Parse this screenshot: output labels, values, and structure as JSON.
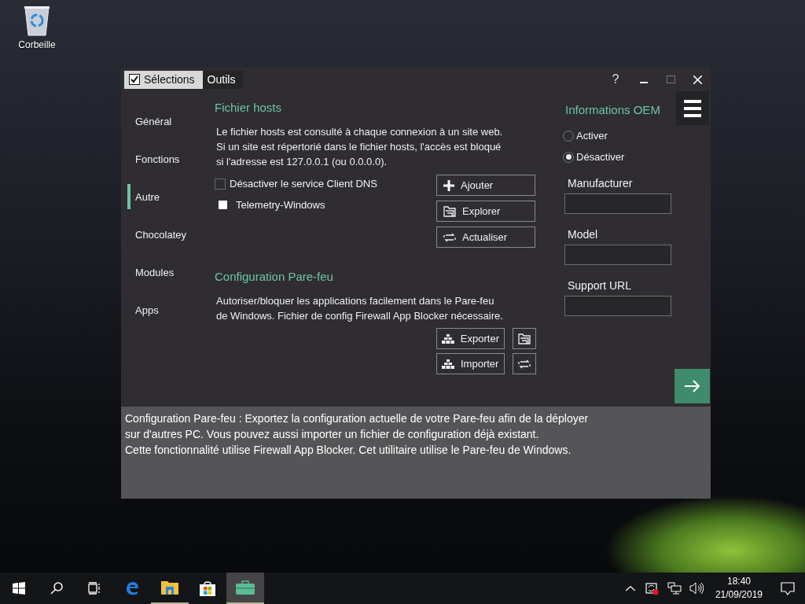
{
  "desktop_icons": [
    {
      "label": "Corbeille"
    }
  ],
  "window": {
    "tabs": [
      {
        "label": "Sélections",
        "selected": true,
        "checked": true
      },
      {
        "label": "Outils",
        "selected": false,
        "checked": false
      }
    ],
    "help": "?"
  },
  "sidebar": {
    "items": [
      {
        "label": "Général",
        "selected": false
      },
      {
        "label": "Fonctions",
        "selected": false
      },
      {
        "label": "Autre",
        "selected": true
      },
      {
        "label": "Chocolatey",
        "selected": false
      },
      {
        "label": "Modules",
        "selected": false
      },
      {
        "label": "Apps",
        "selected": false
      }
    ]
  },
  "hosts": {
    "title": "Fichier hosts",
    "description": "Le fichier hosts est consulté à chaque connexion à un site web.\nSi un site est répertorié dans le fichier hosts, l'accès est bloqué\nsi l'adresse est 127.0.0.1 (ou 0.0.0.0).",
    "options": [
      {
        "label": "Désactiver le service Client DNS",
        "kind": "checkbox",
        "checked": false
      },
      {
        "label": "Telemetry-Windows",
        "kind": "bullet"
      }
    ],
    "buttons": [
      {
        "label": "Ajouter",
        "kind": "plus"
      },
      {
        "label": "Explorer",
        "kind": "folder"
      },
      {
        "label": "Actualiser",
        "kind": "refresh"
      }
    ]
  },
  "firewall": {
    "title": "Configuration Pare-feu",
    "description": "Autoriser/bloquer les applications facilement dans le Pare-feu\nde Windows. Fichier de config Firewall App Blocker nécessaire.",
    "buttons": [
      {
        "label": "Exporter",
        "kind": "wall"
      },
      {
        "kind": "folder"
      },
      {
        "label": "Importer",
        "kind": "wall"
      },
      {
        "kind": "refresh"
      }
    ]
  },
  "oem": {
    "title": "Informations OEM",
    "radios": [
      {
        "label": "Activer",
        "selected": false
      },
      {
        "label": "Désactiver",
        "selected": true
      }
    ],
    "fields": [
      {
        "label": "Manufacturer"
      },
      {
        "label": "Model"
      },
      {
        "label": "Support URL"
      }
    ]
  },
  "info_panel": {
    "text": "Configuration Pare-feu : Exportez la configuration actuelle de votre Pare-feu afin de la déployer\nsur d'autres PC. Vous pouvez aussi importer un fichier de configuration déjà existant.\nCette fonctionnalité utilise Firewall App Blocker. Cet utilitaire utilise le Pare-feu de Windows."
  },
  "taskbar": {
    "apps": [
      {
        "kind": "edge",
        "selected": false,
        "running": false
      },
      {
        "kind": "folder",
        "selected": false,
        "running": true
      },
      {
        "kind": "store",
        "selected": false,
        "running": false
      },
      {
        "kind": "toolbox",
        "selected": true,
        "running": true
      }
    ],
    "time": "18:40",
    "date": "21/09/2019"
  }
}
